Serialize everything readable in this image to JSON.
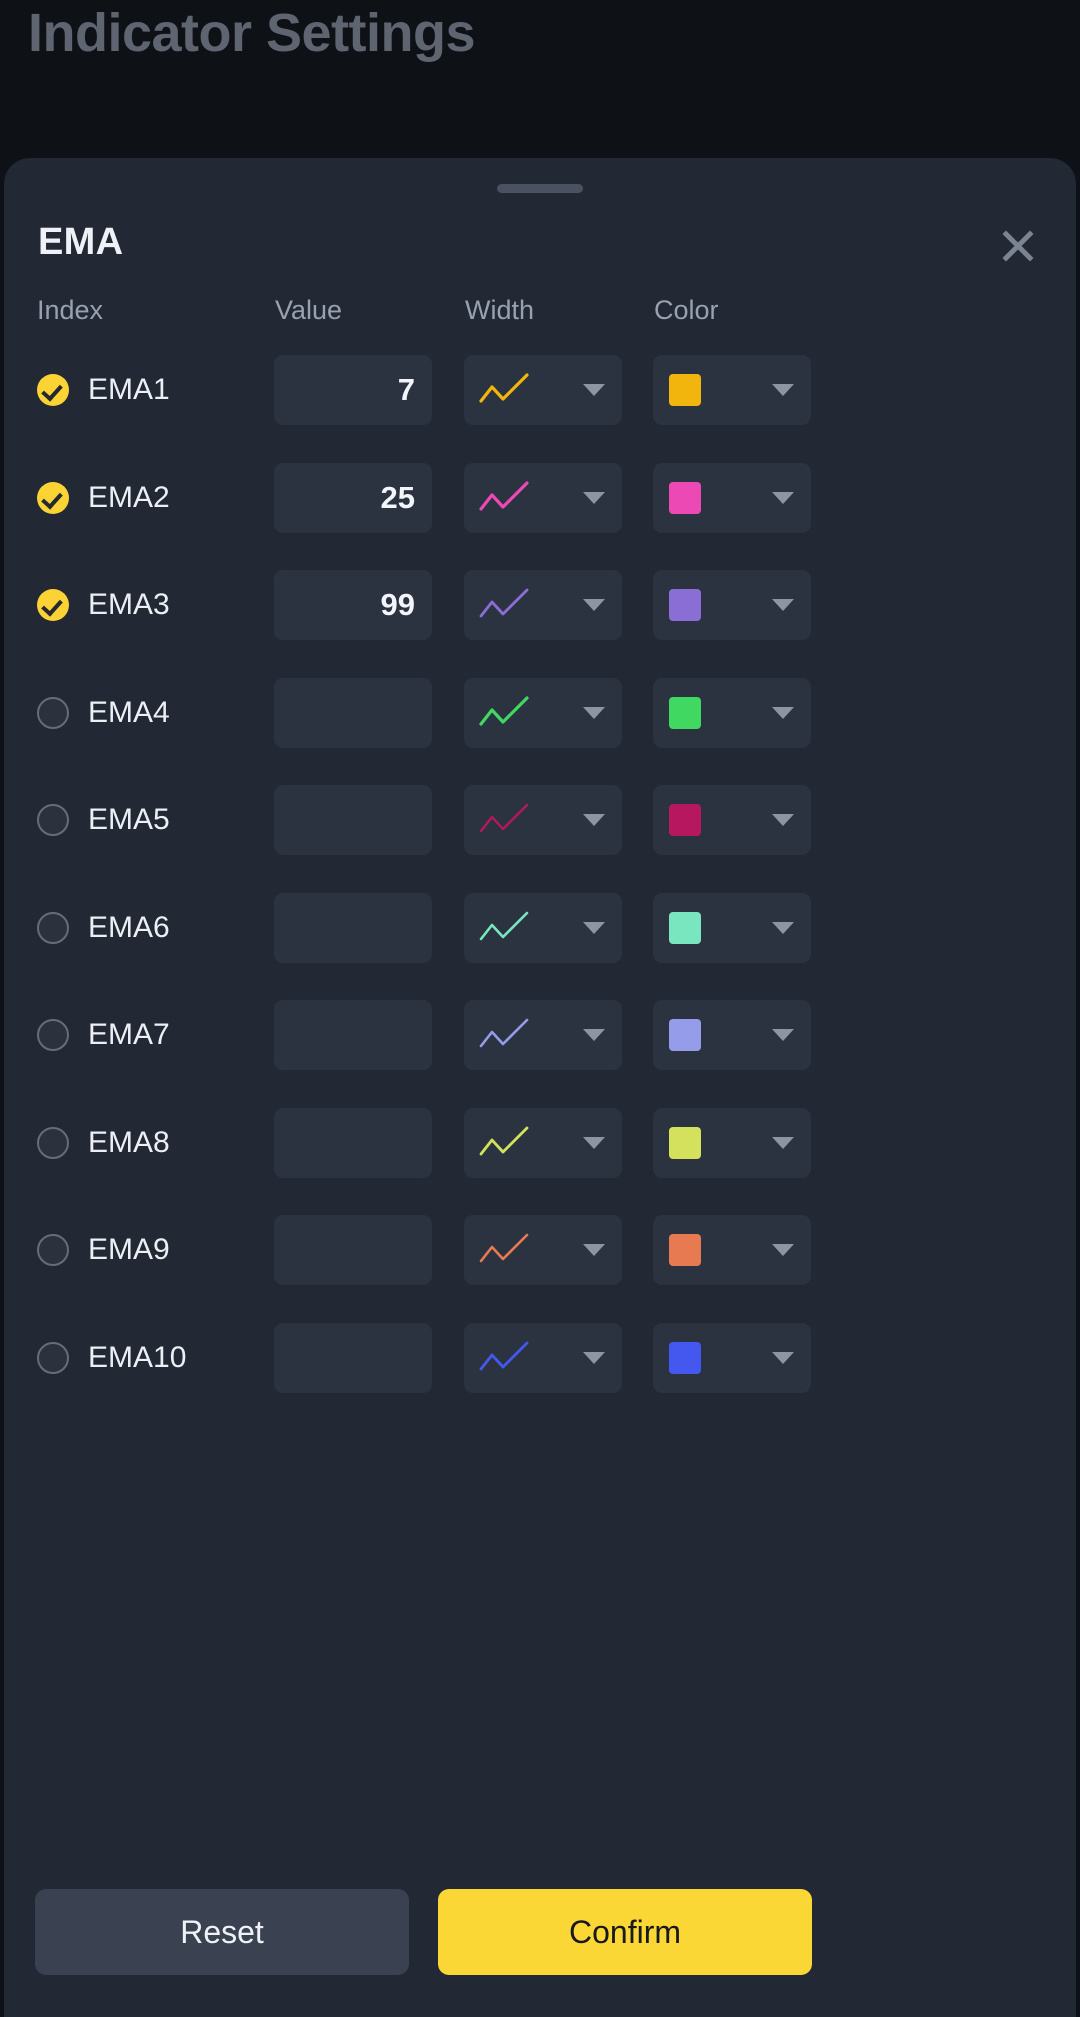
{
  "backdrop": {
    "title": "Indicator Settings"
  },
  "sheet": {
    "title": "EMA",
    "close_icon": "close-icon",
    "drag_handle": "drag-handle"
  },
  "columns": {
    "index": "Index",
    "value": "Value",
    "width": "Width",
    "color": "Color"
  },
  "rows": [
    {
      "label": "EMA1",
      "checked": true,
      "value": "7",
      "color": "#f2b50d",
      "line_width": 3.2
    },
    {
      "label": "EMA2",
      "checked": true,
      "value": "25",
      "color": "#ed49b4",
      "line_width": 3.2
    },
    {
      "label": "EMA3",
      "checked": true,
      "value": "99",
      "color": "#8b6dd6",
      "line_width": 2.8
    },
    {
      "label": "EMA4",
      "checked": false,
      "value": "",
      "color": "#41d862",
      "line_width": 3.2
    },
    {
      "label": "EMA5",
      "checked": false,
      "value": "",
      "color": "#b6175e",
      "line_width": 2.4
    },
    {
      "label": "EMA6",
      "checked": false,
      "value": "",
      "color": "#79e6c0",
      "line_width": 2.6
    },
    {
      "label": "EMA7",
      "checked": false,
      "value": "",
      "color": "#959ce9",
      "line_width": 2.6
    },
    {
      "label": "EMA8",
      "checked": false,
      "value": "",
      "color": "#d3e15d",
      "line_width": 2.8
    },
    {
      "label": "EMA9",
      "checked": false,
      "value": "",
      "color": "#e87a51",
      "line_width": 2.6
    },
    {
      "label": "EMA10",
      "checked": false,
      "value": "",
      "color": "#4458f0",
      "line_width": 2.8
    }
  ],
  "footer": {
    "reset_label": "Reset",
    "confirm_label": "Confirm"
  },
  "theme": {
    "sheet_background": "#222834",
    "backdrop_background": "#0e1116",
    "control_background": "#2c3340",
    "accent": "#fbd735",
    "muted_text": "#98a1b0",
    "primary_text": "#eef1f5"
  }
}
